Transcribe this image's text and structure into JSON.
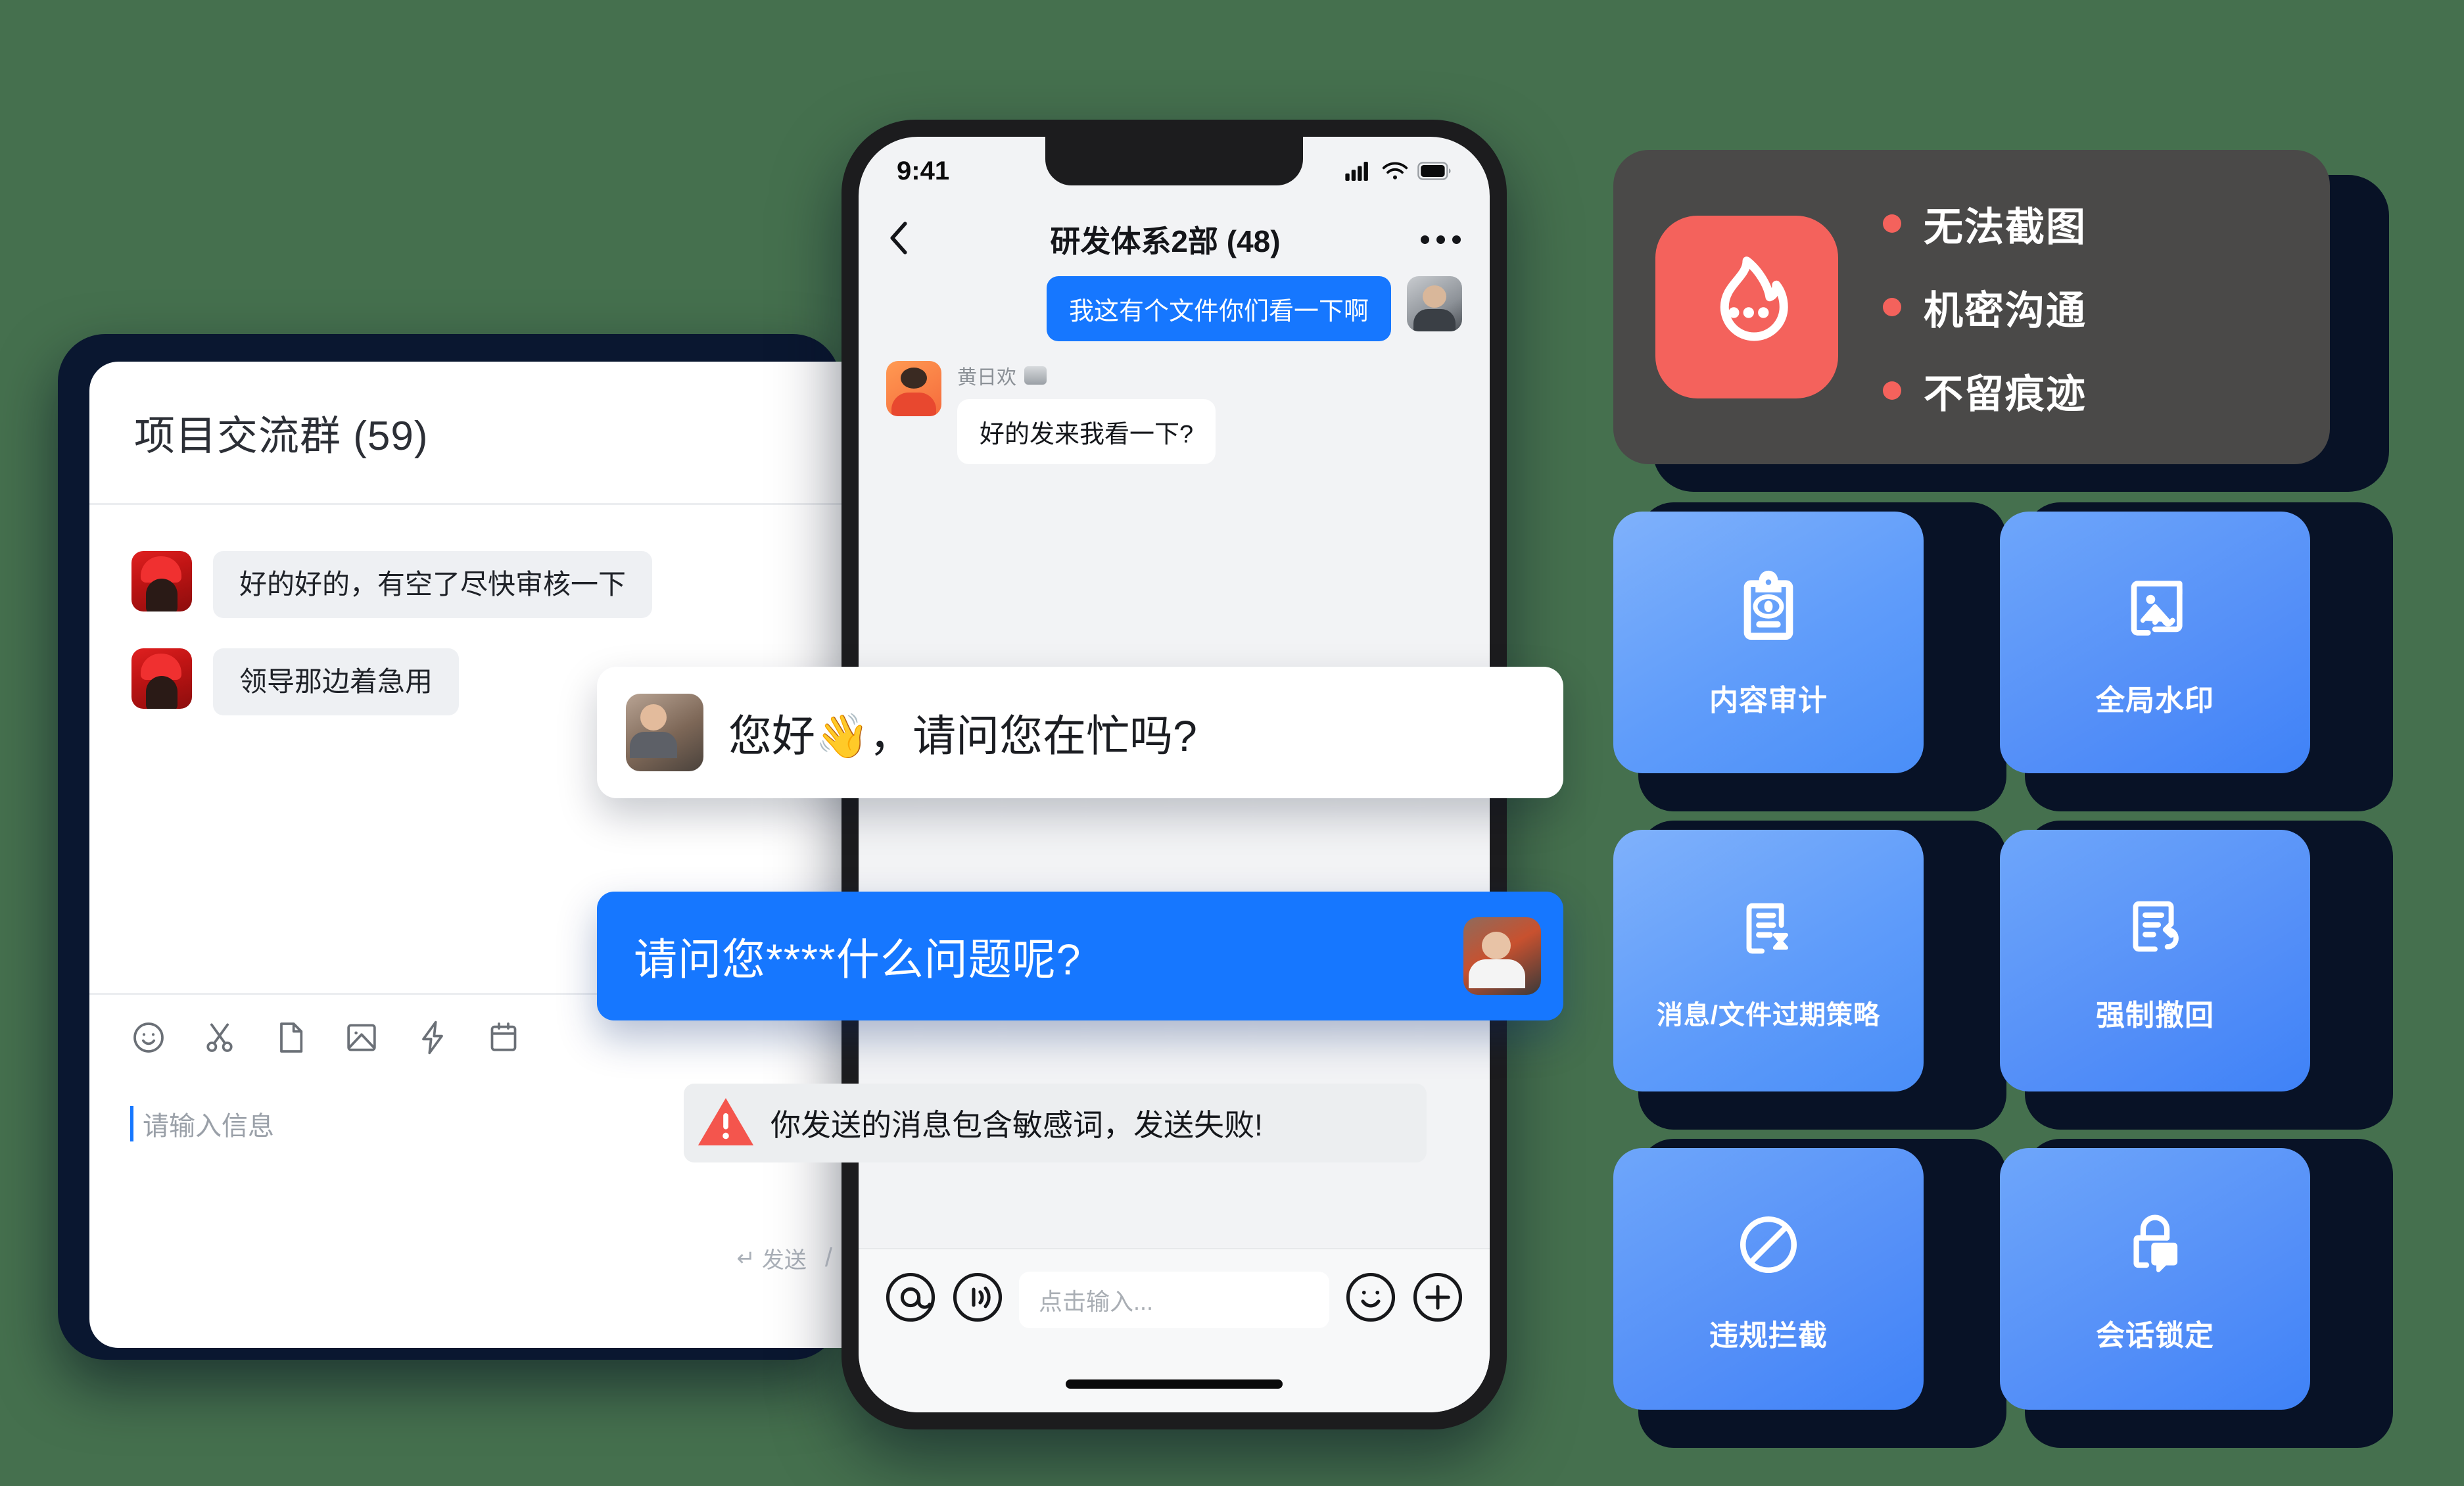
{
  "desktop": {
    "title": "项目交流群 (59)",
    "messages": [
      {
        "avatar": "woman-red-hat-avatar",
        "text": "好的好的，有空了尽快审核一下"
      },
      {
        "avatar": "woman-red-hat-avatar",
        "text": "领导那边着急用"
      }
    ],
    "toolbar_icons": [
      "emoji-icon",
      "scissors-icon",
      "file-icon",
      "image-icon",
      "lightning-icon",
      "calendar-icon"
    ],
    "input_placeholder": "请输入信息",
    "send_label": "发送",
    "send_enter_symbol": "↵",
    "send_divider": "/"
  },
  "phone": {
    "status": {
      "time": "9:41",
      "signal": "cellular-signal-icon",
      "wifi": "wifi-icon",
      "battery": "battery-icon"
    },
    "nav": {
      "back": "back-chevron-icon",
      "title": "研发体系2部 (48)",
      "more": "more-dots-icon"
    },
    "messages": [
      {
        "side": "out",
        "text": "我这有个文件你们看一下啊",
        "avatar": "man-glasses-avatar"
      },
      {
        "side": "in",
        "sender": "黄日欢",
        "badge": "rank-badge-icon",
        "text": "好的发来我看一下?",
        "avatar": "man-sunglasses-avatar"
      }
    ],
    "input": {
      "mention_icon": "at-icon",
      "voice_icon": "voice-broadcast-icon",
      "placeholder": "点击输入...",
      "emoji_icon": "emoji-icon",
      "plus_icon": "plus-icon"
    }
  },
  "floating": {
    "white_bubble": {
      "avatar": "man-glasses-portrait-avatar",
      "text": "您好👋，请问您在忙吗?"
    },
    "blue_bubble": {
      "text": "请问您****什么问题呢?",
      "avatar": "man-graffiti-avatar"
    },
    "warning": {
      "icon": "warning-triangle-icon",
      "text": "你发送的消息包含敏感词，发送失败!"
    }
  },
  "right_panel": {
    "highlight_card": {
      "app_icon": "flame-chat-icon",
      "icon_bg": "#f4625c",
      "card_bg": "#4a4948",
      "bullets": [
        "无法截图",
        "机密沟通",
        "不留痕迹"
      ]
    },
    "features": [
      {
        "icon": "content-audit-icon",
        "label": "内容审计"
      },
      {
        "icon": "global-watermark-icon",
        "label": "全局水印"
      },
      {
        "icon": "expiry-policy-icon",
        "label": "消息/文件过期策略"
      },
      {
        "icon": "force-recall-icon",
        "label": "强制撤回"
      },
      {
        "icon": "block-violation-icon",
        "label": "违规拦截"
      },
      {
        "icon": "session-lock-icon",
        "label": "会话锁定"
      }
    ]
  },
  "colors": {
    "background": "#45704e",
    "accent_blue": "#1677ff",
    "card_blue": "#5f9cfa",
    "plate_navy": "#081226",
    "accent_red": "#f4625c"
  }
}
